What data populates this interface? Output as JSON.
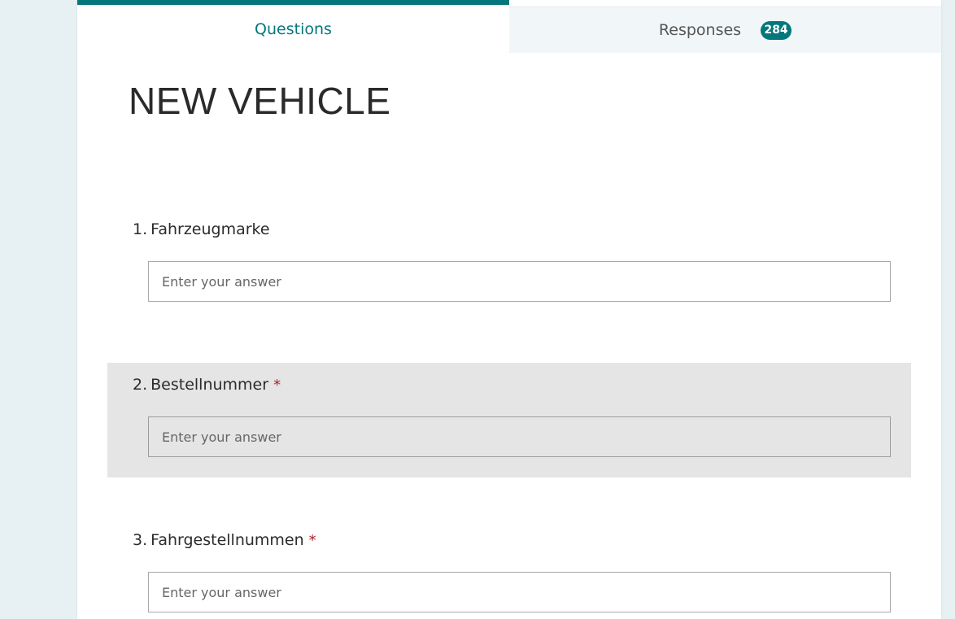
{
  "tabs": {
    "questions_label": "Questions",
    "responses_label": "Responses",
    "responses_count": "284"
  },
  "form": {
    "title": "NEW VEHICLE"
  },
  "questions": [
    {
      "number": "1.",
      "label": "Fahrzeugmarke",
      "required": false,
      "required_mark": "",
      "placeholder": "Enter your answer",
      "value": ""
    },
    {
      "number": "2.",
      "label": "Bestellnummer",
      "required": true,
      "required_mark": "*",
      "placeholder": "Enter your answer",
      "value": ""
    },
    {
      "number": "3.",
      "label": "Fahrgestellnummen",
      "required": true,
      "required_mark": "*",
      "placeholder": "Enter your answer",
      "value": ""
    }
  ],
  "colors": {
    "accent": "#03787c",
    "required": "#a4262c",
    "highlight_bg": "#e5e5e5",
    "page_bg": "#e7f0f2"
  }
}
